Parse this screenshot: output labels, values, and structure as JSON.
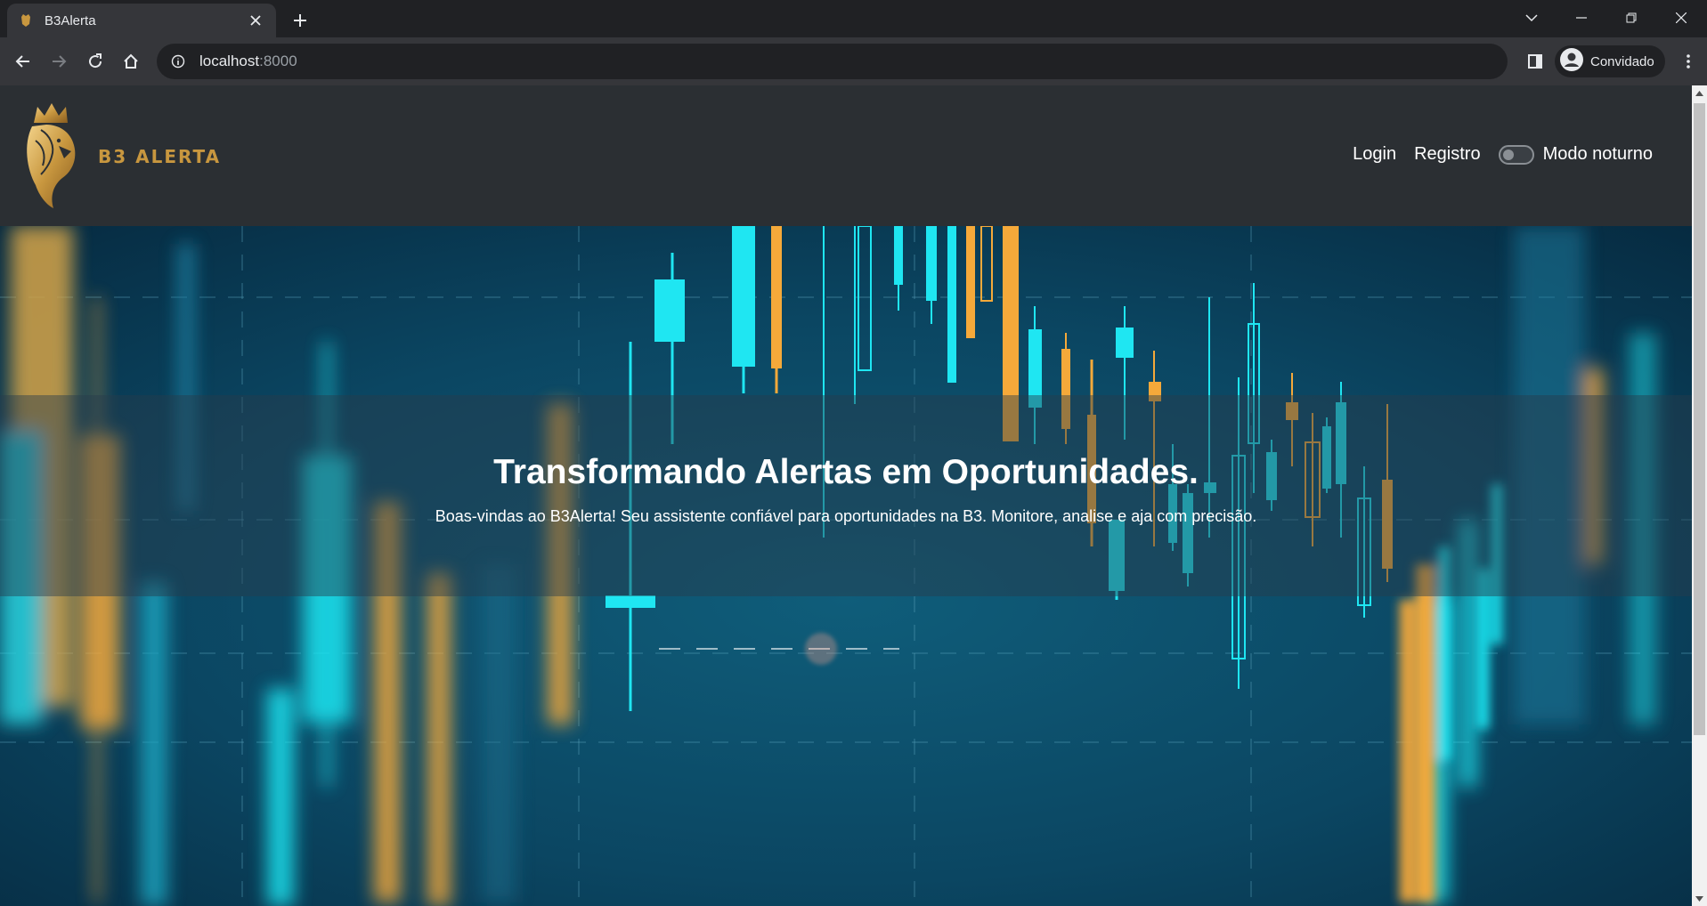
{
  "browser": {
    "tab_title": "B3Alerta",
    "url_host": "localhost",
    "url_port": ":8000",
    "profile_label": "Convidado"
  },
  "site": {
    "logo_text": "B3 ALERTA",
    "nav": {
      "login": "Login",
      "register": "Registro",
      "dark_mode": "Modo noturno",
      "dark_mode_on": false
    }
  },
  "hero": {
    "title": "Transformando Alertas em Oportunidades.",
    "subtitle": "Boas-vindas ao B3Alerta! Seu assistente confiável para oportunidades na B3. Monitore, analise e aja com precisão."
  },
  "colors": {
    "gold": "#c8973f",
    "cyan": "#1fe6f2",
    "orange": "#f5a93a",
    "header_bg": "#2b2f33"
  }
}
